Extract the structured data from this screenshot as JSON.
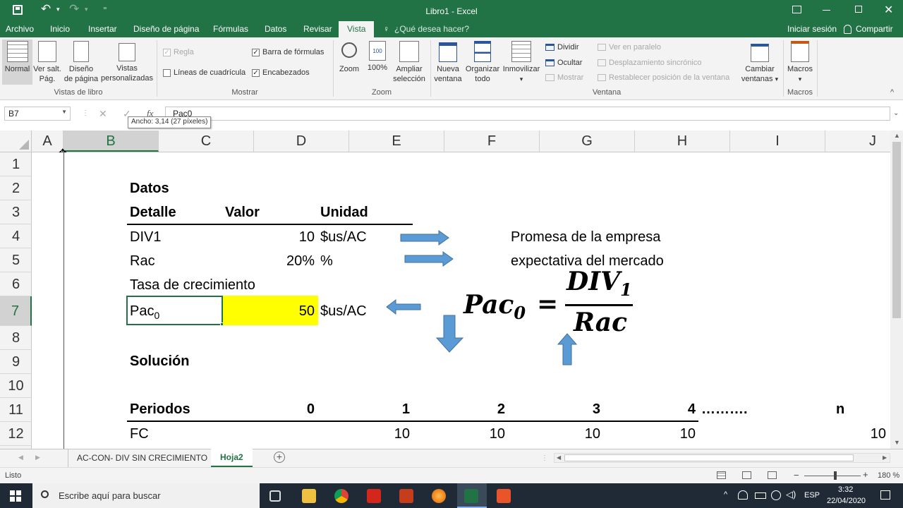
{
  "window": {
    "title": "Libro1 - Excel",
    "qat_more": "⁼"
  },
  "tabs": [
    "Archivo",
    "Inicio",
    "Insertar",
    "Diseño de página",
    "Fórmulas",
    "Datos",
    "Revisar",
    "Vista"
  ],
  "active_tab": "Vista",
  "tell_me": "¿Qué desea hacer?",
  "account": {
    "signin": "Iniciar sesión",
    "share": "Compartir"
  },
  "ribbon": {
    "vistas": {
      "label": "Vistas de libro",
      "normal": "Normal",
      "saltos": [
        "Ver salt.",
        "Pág."
      ],
      "diseno": [
        "Diseño",
        "de página"
      ],
      "personal": [
        "Vistas",
        "personalizadas"
      ]
    },
    "mostrar": {
      "label": "Mostrar",
      "regla": "Regla",
      "lineas": "Líneas de cuadrícula",
      "barra": "Barra de fórmulas",
      "encabezados": "Encabezados",
      "check": "✓"
    },
    "zoom": {
      "label": "Zoom",
      "zoom": "Zoom",
      "cien": "100%",
      "ampliar": [
        "Ampliar",
        "selección"
      ]
    },
    "ventana": {
      "label": "Ventana",
      "nueva": [
        "Nueva",
        "ventana"
      ],
      "organizar": [
        "Organizar",
        "todo"
      ],
      "inmovilizar": "Inmovilizar",
      "dividir": "Dividir",
      "ocultar": "Ocultar",
      "mostrar": "Mostrar",
      "paralelo": "Ver en paralelo",
      "sincronico": "Desplazamiento sincrónico",
      "restablecer": "Restablecer posición de la ventana",
      "cambiar": [
        "Cambiar",
        "ventanas"
      ]
    },
    "macros": {
      "label": "Macros",
      "macros": "Macros"
    },
    "arrow": "▾"
  },
  "formula_bar": {
    "name_box": "B7",
    "cancel": "✕",
    "enter": "✓",
    "fx": "fx",
    "content": "Pac0",
    "tooltip": "Ancho: 3,14 (27 píxeles)"
  },
  "columns": [
    "A",
    "B",
    "C",
    "D",
    "E",
    "F",
    "G",
    "H",
    "I",
    "J"
  ],
  "rows": [
    "1",
    "2",
    "3",
    "4",
    "5",
    "6",
    "7",
    "8",
    "9",
    "10",
    "11",
    "12"
  ],
  "cells": {
    "datos": "Datos",
    "detalle": "Detalle",
    "valor": "Valor",
    "unidad": "Unidad",
    "div1": "DIV1",
    "div1_val": "10",
    "div1_unit": "$us/AC",
    "rac": "Rac",
    "rac_val": "20%",
    "rac_unit": "%",
    "tasa": "Tasa de crecimiento",
    "pac": "Pac",
    "pac_sub": "0",
    "pac_val": "50",
    "pac_unit": "$us/AC",
    "promesa": "Promesa de la empresa",
    "expectativa": "expectativa del mercado",
    "solucion": "Solución",
    "periodos": "Periodos",
    "p0": "0",
    "p1": "1",
    "p2": "2",
    "p3": "3",
    "p4": "4",
    "dots": "……….",
    "pn": "n",
    "fc": "FC",
    "fc1": "10",
    "fc2": "10",
    "fc3": "10",
    "fc4": "10",
    "fcn": "10"
  },
  "formula": {
    "lhs": "Pac",
    "lhs_sub": "0",
    "eq": "=",
    "num": "DIV",
    "num_sub": "1",
    "den": "Rac"
  },
  "sheets": [
    "AC-CON- DIV SIN CRECIMIENTO",
    "Hoja2"
  ],
  "active_sheet": "Hoja2",
  "add_sheet": "+",
  "status": {
    "ready": "Listo",
    "zoom": "180 %",
    "minus": "−",
    "plus": "+"
  },
  "taskbar": {
    "search": "Escribe aquí para buscar",
    "lang": "ESP",
    "time": "3:32",
    "date": "22/04/2020"
  },
  "colors": {
    "excel_green": "#217346",
    "highlight": "#ffff00",
    "arrow_blue": "#5b9bd5"
  }
}
